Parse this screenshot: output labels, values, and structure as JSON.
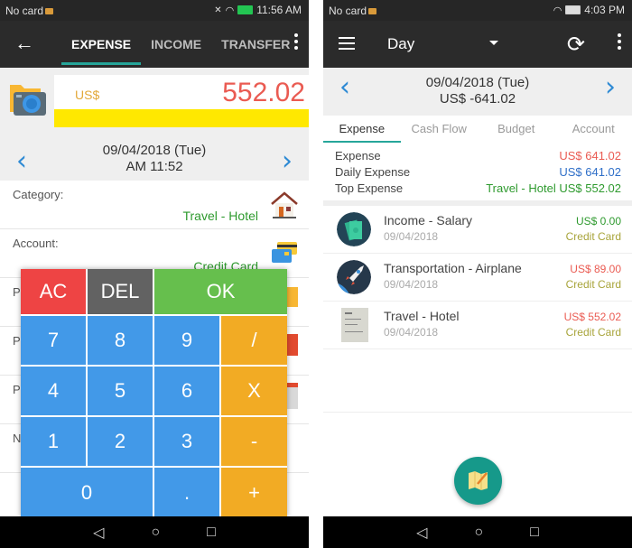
{
  "left": {
    "status": {
      "carrier": "No card",
      "time": "11:56 AM"
    },
    "appbar": {
      "tabs": [
        {
          "label": "EXPENSE",
          "active": true
        },
        {
          "label": "INCOME",
          "active": false
        },
        {
          "label": "TRANSFER",
          "active": false
        }
      ]
    },
    "amount": {
      "currency": "US$",
      "value": "552.02"
    },
    "date": {
      "line1": "09/04/2018 (Tue)",
      "line2": "AM 11:52"
    },
    "fields": [
      {
        "label": "Category:",
        "value": "Travel - Hotel",
        "icon": "house-icon"
      },
      {
        "label": "Account:",
        "value": "Credit Card",
        "icon": "credit-card-icon"
      }
    ],
    "hidden_labels": [
      "P",
      "P",
      "P",
      "N"
    ],
    "keypad": {
      "row0": [
        "AC",
        "DEL",
        "OK"
      ],
      "row1": [
        "7",
        "8",
        "9",
        "/"
      ],
      "row2": [
        "4",
        "5",
        "6",
        "X"
      ],
      "row3": [
        "1",
        "2",
        "3",
        "-"
      ],
      "row4": [
        "0",
        ".",
        "+"
      ]
    }
  },
  "right": {
    "status": {
      "carrier": "No card",
      "time": "4:03 PM"
    },
    "appbar": {
      "period": "Day"
    },
    "date": {
      "line1": "09/04/2018 (Tue)",
      "line2": "US$ -641.02"
    },
    "tabs": [
      {
        "label": "Expense",
        "active": true
      },
      {
        "label": "Cash Flow",
        "active": false
      },
      {
        "label": "Budget",
        "active": false
      },
      {
        "label": "Account",
        "active": false
      }
    ],
    "summary": [
      {
        "label": "Expense",
        "value": "US$ 641.02",
        "color": "#ea5b52"
      },
      {
        "label": "Daily Expense",
        "value": "US$ 641.02",
        "color": "#2f6fc8"
      },
      {
        "label": "Top Expense",
        "value": "Travel - Hotel US$ 552.02",
        "color": "#2e9a2e"
      }
    ],
    "transactions": [
      {
        "title": "Income - Salary",
        "date": "09/04/2018",
        "amount": "US$ 0.00",
        "amount_color": "#2e9a2e",
        "account": "Credit Card",
        "icon": "money-icon"
      },
      {
        "title": "Transportation - Airplane",
        "date": "09/04/2018",
        "amount": "US$ 89.00",
        "amount_color": "#ea5b52",
        "account": "Credit Card",
        "icon": "rocket-icon"
      },
      {
        "title": "Travel - Hotel",
        "date": "09/04/2018",
        "amount": "US$ 552.02",
        "amount_color": "#ea5b52",
        "account": "Credit Card",
        "icon": "receipt-icon"
      }
    ]
  }
}
